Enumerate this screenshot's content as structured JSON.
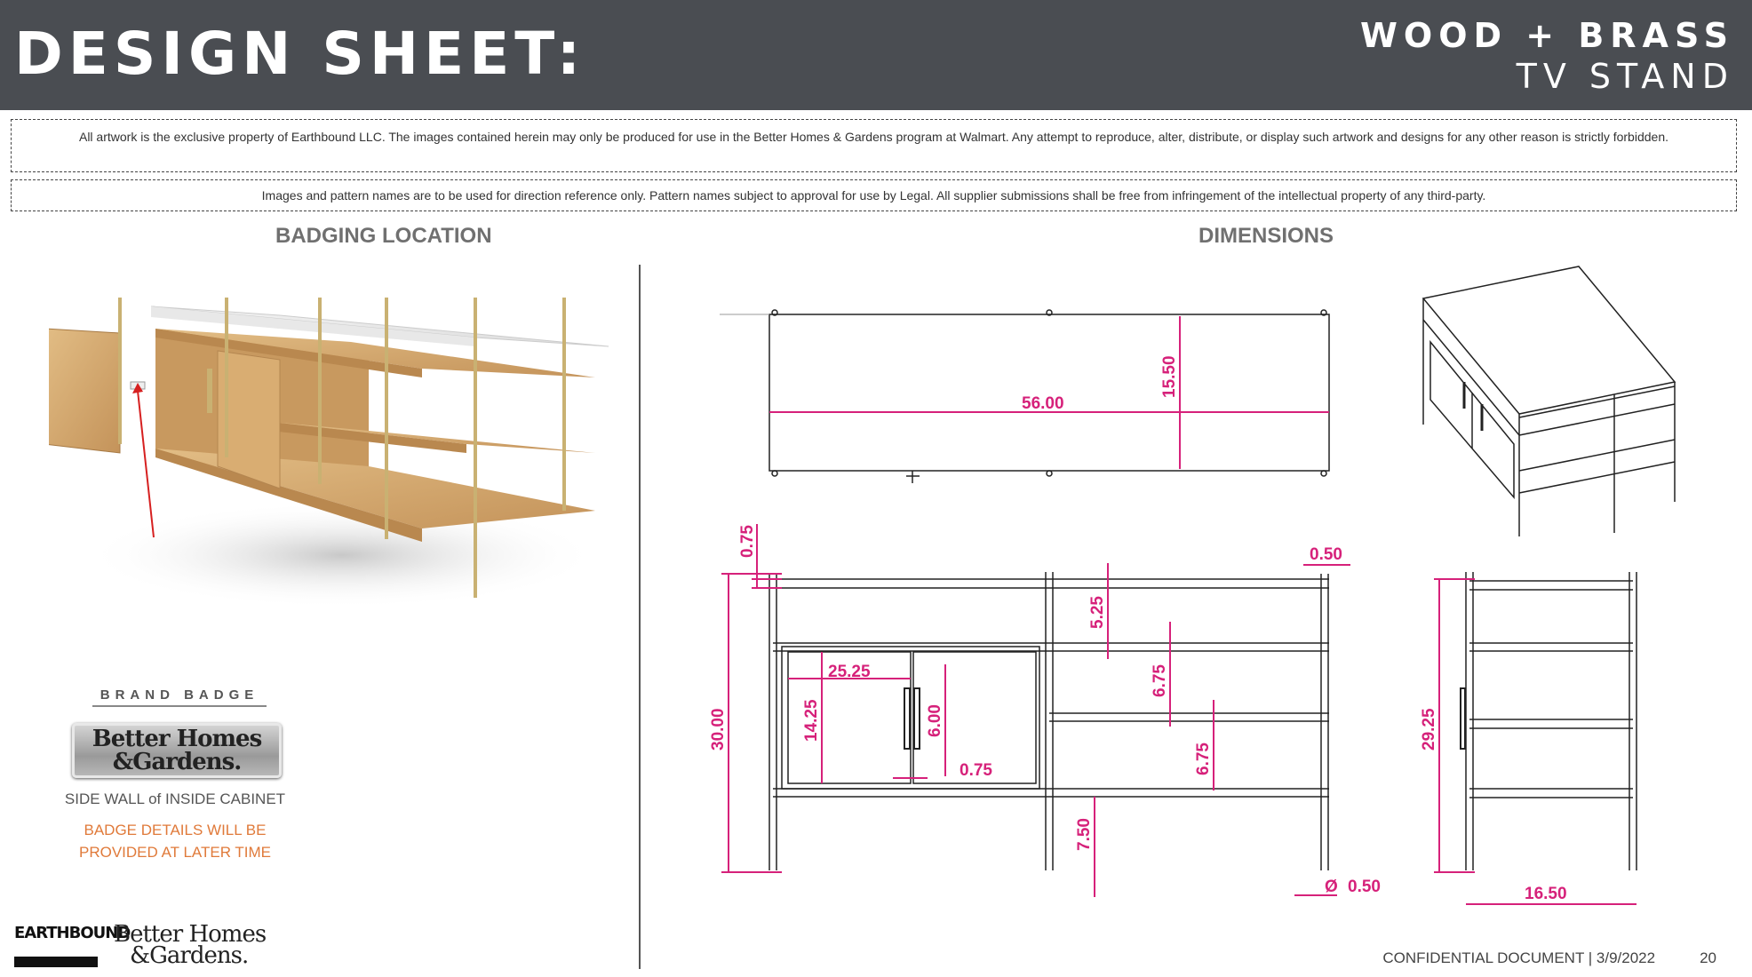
{
  "header": {
    "title": "DESIGN SHEET:",
    "subtitle_line1": "WOOD + BRASS",
    "subtitle_line2": "TV STAND"
  },
  "notices": {
    "property": "All artwork is the exclusive property of Earthbound LLC. The images contained herein may only be produced for use in the Better Homes & Gardens program at Walmart. Any attempt to reproduce, alter, distribute, or display such artwork and designs for any other reason is strictly forbidden.",
    "reference": "Images and pattern names are to be used for direction reference only.  Pattern names subject to approval for use by Legal. All supplier submissions shall be free from infringement of the intellectual property of any third-party."
  },
  "badging": {
    "section_title": "BADGING LOCATION",
    "badge_label": "BRAND BADGE",
    "badge_brand_line1": "Better Homes",
    "badge_brand_line2": "&Gardens.",
    "caption": "SIDE WALL of INSIDE CABINET",
    "note_line1": "BADGE DETAILS WILL BE",
    "note_line2": "PROVIDED AT LATER TIME"
  },
  "dimensions": {
    "section_title": "DIMENSIONS",
    "top_width": "56.00",
    "top_depth": "15.50",
    "front_overhang": "0.75",
    "front_leg_offset": "0.50",
    "front_height": "30.00",
    "door_width": "25.25",
    "door_height": "14.25",
    "handle_height": "6.00",
    "handle_gap": "0.75",
    "shelf_gap_top": "5.25",
    "shelf_gap_mid": "6.75",
    "shelf_gap_low": "6.75",
    "bottom_clearance": "7.50",
    "leg_diameter_symbol": "Ø",
    "leg_diameter": "0.50",
    "side_height": "29.25",
    "side_depth": "16.50"
  },
  "logos": {
    "earthbound": "EARTHBOUND",
    "bhg_line1": "Better Homes",
    "bhg_line2": "&Gardens."
  },
  "footer": {
    "confidential": "CONFIDENTIAL DOCUMENT | 3/9/2022",
    "page_number": "20"
  },
  "colors": {
    "header_bg": "#4a4d52",
    "dimension": "#d6217a",
    "badge_note": "#e07a3a",
    "brass": "#c9b172",
    "wood": "#d4a86a"
  }
}
